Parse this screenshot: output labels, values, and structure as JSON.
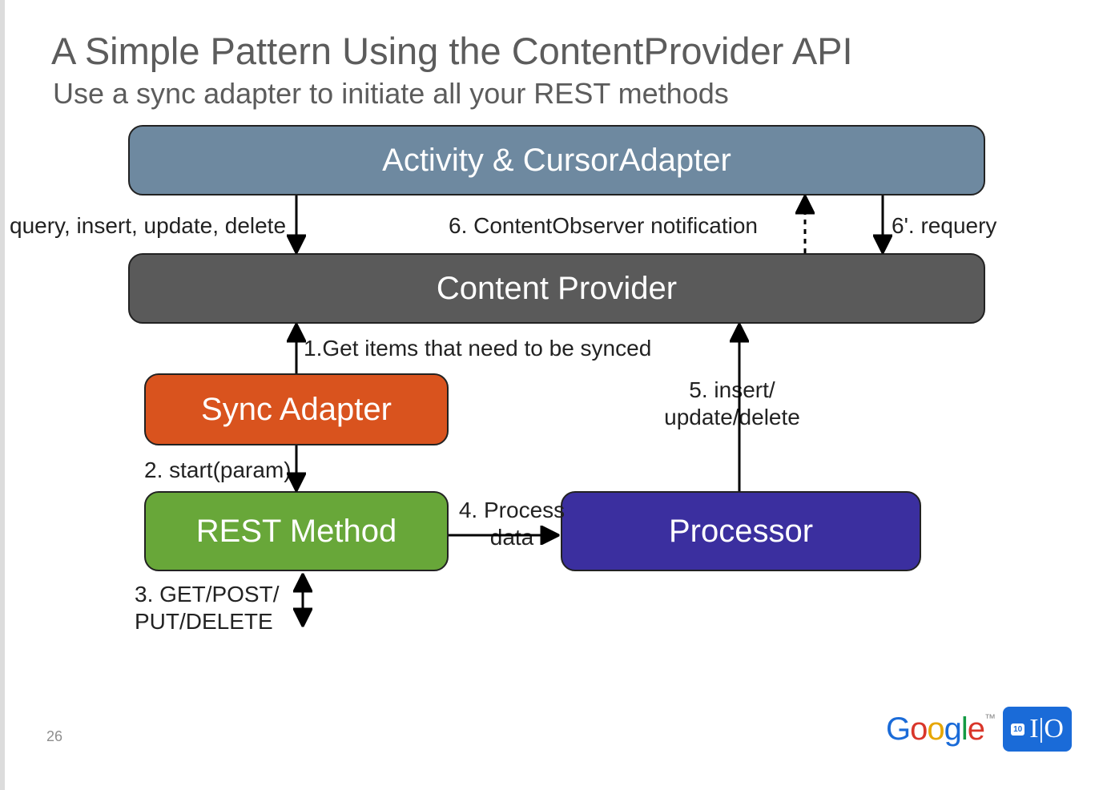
{
  "title": "A Simple Pattern Using the ContentProvider API",
  "subtitle": "Use a sync adapter to initiate all your REST methods",
  "boxes": {
    "activity": "Activity & CursorAdapter",
    "content_provider": "Content Provider",
    "sync_adapter": "Sync Adapter",
    "rest_method": "REST Method",
    "processor": "Processor"
  },
  "labels": {
    "crud": "query, insert, update, delete",
    "step1": "1.Get items that need to be synced",
    "step2": "2. start(param)",
    "step3a": "3. GET/POST/",
    "step3b": "PUT/DELETE",
    "step4a": "4. Process",
    "step4b": "data",
    "step5a": "5. insert/",
    "step5b": "update/delete",
    "step6": "6. ContentObserver notification",
    "step6p": "6'. requery"
  },
  "page_number": "26",
  "logo": {
    "google": "Google",
    "tm": "™",
    "io_year": "10",
    "io": "I|O"
  }
}
